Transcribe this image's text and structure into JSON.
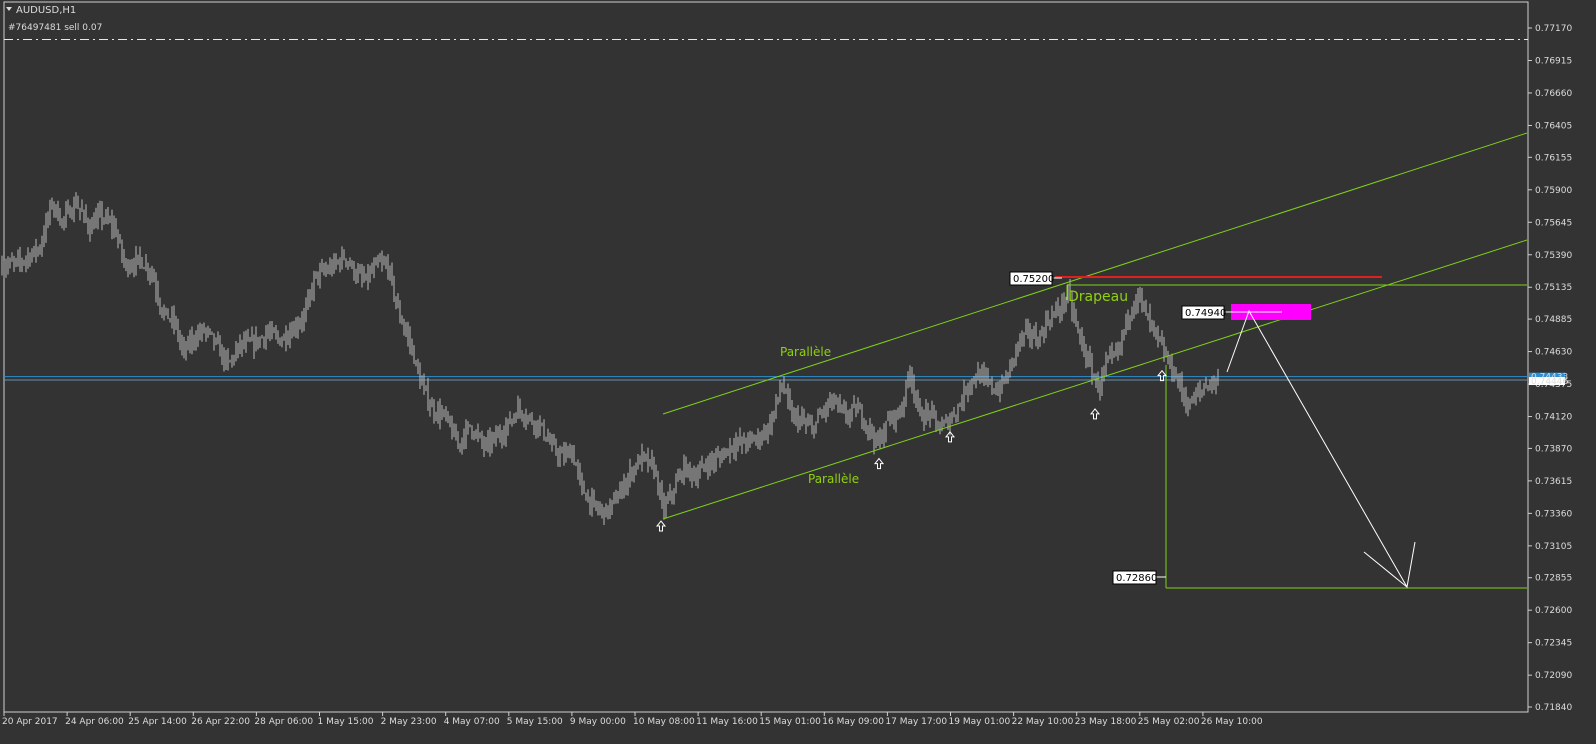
{
  "window": {
    "symbol_label": "AUDUSD,H1",
    "order_label": "#76497481 sell 0.07"
  },
  "colors": {
    "background": "#333333",
    "candles": "#b9b9b9",
    "channel": "#7fd11a",
    "resistance": "#e02020",
    "target_box": "#ff00ff",
    "current_price_line": "#2f8fd0",
    "projection": "#ffffff",
    "axis": "#d0d0d0"
  },
  "chart_data": {
    "type": "candlestick",
    "symbol": "AUDUSD",
    "timeframe": "H1",
    "y_axis_ticks": [
      "0.77170",
      "0.76915",
      "0.76660",
      "0.76405",
      "0.76155",
      "0.75900",
      "0.75645",
      "0.75390",
      "0.75135",
      "0.74885",
      "0.74630",
      "0.74375",
      "0.74120",
      "0.73870",
      "0.73615",
      "0.73360",
      "0.73105",
      "0.72855",
      "0.72600",
      "0.72345",
      "0.72090",
      "0.71840"
    ],
    "ylim": [
      0.7184,
      0.7717
    ],
    "x_axis_ticks": [
      "20 Apr 2017",
      "24 Apr 06:00",
      "25 Apr 14:00",
      "26 Apr 22:00",
      "28 Apr 06:00",
      "1 May 15:00",
      "2 May 23:00",
      "4 May 07:00",
      "5 May 15:00",
      "9 May 00:00",
      "10 May 08:00",
      "11 May 16:00",
      "15 May 01:00",
      "16 May 09:00",
      "17 May 17:00",
      "19 May 01:00",
      "22 May 10:00",
      "23 May 18:00",
      "25 May 02:00",
      "26 May 10:00"
    ],
    "price_path": [
      [
        0,
        0.753
      ],
      [
        20,
        0.7533
      ],
      [
        40,
        0.7545
      ],
      [
        52,
        0.758
      ],
      [
        62,
        0.7565
      ],
      [
        76,
        0.758
      ],
      [
        90,
        0.756
      ],
      [
        100,
        0.757
      ],
      [
        115,
        0.756
      ],
      [
        125,
        0.753
      ],
      [
        140,
        0.7535
      ],
      [
        152,
        0.7525
      ],
      [
        162,
        0.7495
      ],
      [
        175,
        0.7485
      ],
      [
        183,
        0.7462
      ],
      [
        195,
        0.7475
      ],
      [
        205,
        0.748
      ],
      [
        215,
        0.747
      ],
      [
        228,
        0.7452
      ],
      [
        240,
        0.7468
      ],
      [
        255,
        0.747
      ],
      [
        268,
        0.7478
      ],
      [
        280,
        0.7472
      ],
      [
        292,
        0.748
      ],
      [
        305,
        0.7492
      ],
      [
        315,
        0.7522
      ],
      [
        330,
        0.7528
      ],
      [
        345,
        0.7538
      ],
      [
        355,
        0.7525
      ],
      [
        365,
        0.7518
      ],
      [
        378,
        0.7532
      ],
      [
        388,
        0.753
      ],
      [
        398,
        0.7495
      ],
      [
        410,
        0.747
      ],
      [
        420,
        0.744
      ],
      [
        432,
        0.7418
      ],
      [
        445,
        0.7412
      ],
      [
        458,
        0.739
      ],
      [
        470,
        0.7405
      ],
      [
        485,
        0.7388
      ],
      [
        495,
        0.7395
      ],
      [
        505,
        0.7402
      ],
      [
        518,
        0.7418
      ],
      [
        530,
        0.741
      ],
      [
        540,
        0.7405
      ],
      [
        552,
        0.7388
      ],
      [
        562,
        0.738
      ],
      [
        572,
        0.7385
      ],
      [
        582,
        0.7355
      ],
      [
        595,
        0.734
      ],
      [
        607,
        0.7337
      ],
      [
        620,
        0.7352
      ],
      [
        632,
        0.737
      ],
      [
        642,
        0.738
      ],
      [
        655,
        0.737
      ],
      [
        663,
        0.7338
      ],
      [
        672,
        0.7352
      ],
      [
        684,
        0.7372
      ],
      [
        695,
        0.7365
      ],
      [
        707,
        0.7375
      ],
      [
        720,
        0.738
      ],
      [
        732,
        0.739
      ],
      [
        745,
        0.7392
      ],
      [
        758,
        0.7395
      ],
      [
        770,
        0.7405
      ],
      [
        782,
        0.7438
      ],
      [
        792,
        0.7412
      ],
      [
        802,
        0.7408
      ],
      [
        812,
        0.7402
      ],
      [
        822,
        0.7415
      ],
      [
        833,
        0.7425
      ],
      [
        845,
        0.7412
      ],
      [
        857,
        0.7418
      ],
      [
        867,
        0.7406
      ],
      [
        878,
        0.739
      ],
      [
        889,
        0.741
      ],
      [
        900,
        0.7415
      ],
      [
        910,
        0.7448
      ],
      [
        920,
        0.7412
      ],
      [
        930,
        0.7415
      ],
      [
        940,
        0.7402
      ],
      [
        950,
        0.741
      ],
      [
        960,
        0.7422
      ],
      [
        968,
        0.7438
      ],
      [
        978,
        0.7445
      ],
      [
        988,
        0.7438
      ],
      [
        998,
        0.7432
      ],
      [
        1008,
        0.7445
      ],
      [
        1018,
        0.747
      ],
      [
        1028,
        0.7478
      ],
      [
        1038,
        0.7472
      ],
      [
        1048,
        0.7488
      ],
      [
        1058,
        0.7495
      ],
      [
        1068,
        0.7508
      ],
      [
        1078,
        0.7478
      ],
      [
        1088,
        0.7455
      ],
      [
        1098,
        0.7435
      ],
      [
        1108,
        0.7455
      ],
      [
        1118,
        0.7462
      ],
      [
        1128,
        0.7492
      ],
      [
        1138,
        0.7508
      ],
      [
        1148,
        0.7488
      ],
      [
        1158,
        0.7472
      ],
      [
        1168,
        0.7455
      ],
      [
        1178,
        0.744
      ],
      [
        1188,
        0.742
      ],
      [
        1198,
        0.743
      ],
      [
        1208,
        0.7438
      ],
      [
        1218,
        0.744
      ]
    ],
    "annotations": {
      "channel_labels": [
        "Parallèle",
        "Parallèle"
      ],
      "flag_label": "Drapeau",
      "resistance_price": "0.75200",
      "target_zone_price": "0.74940",
      "target_price": "0.72860",
      "current_price_1": "0.74433",
      "current_price_2": "0.74446",
      "order_price": 0.7708,
      "current_price": 0.74446,
      "support_markers": [
        [
          661,
          0.733
        ],
        [
          879,
          0.7379
        ],
        [
          950,
          0.74
        ],
        [
          1095,
          0.7418
        ],
        [
          1162,
          0.7448
        ]
      ]
    }
  }
}
